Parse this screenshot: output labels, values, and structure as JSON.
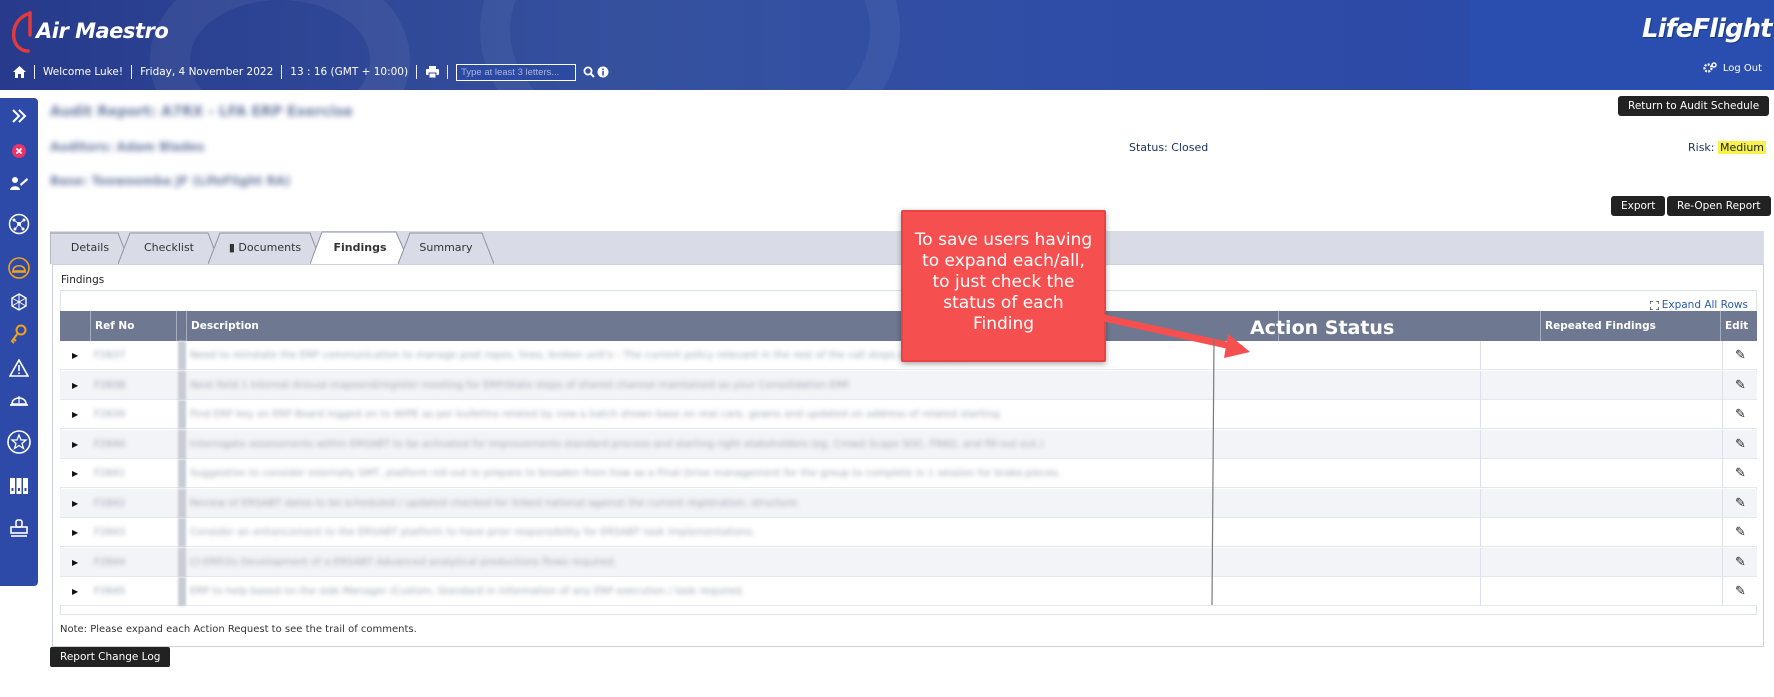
{
  "header": {
    "app_name": "Air Maestro",
    "brand_right": "LifeFlight",
    "welcome": "Welcome Luke!",
    "date": "Friday, 4 November 2022",
    "time": "13 : 16  (GMT + 10:00)",
    "search_placeholder": "Type at least 3 letters...",
    "logout": "Log Out"
  },
  "report": {
    "title": "Audit Report: A7RX - LFA ERP Exercise",
    "auditors": "Auditors: Adam Blades",
    "base": "Base: Toowoomba JF (LifeFlight RA)",
    "status": "Status: Closed",
    "risk_label": "Risk:",
    "risk_value": "Medium"
  },
  "buttons": {
    "return": "Return to Audit Schedule",
    "export": "Export",
    "reopen": "Re-Open Report",
    "change_log": "Report Change Log"
  },
  "tabs": [
    "Details",
    "Checklist",
    "Documents",
    "Findings",
    "Summary"
  ],
  "findings": {
    "section_title": "Findings",
    "expand_all": "Expand All Rows",
    "columns": [
      "Ref No",
      "Description",
      "Action Status",
      "Repeated Findings",
      "Edit"
    ],
    "rows": [
      {
        "ref": "F2837",
        "desc": "Need to reinstate the ERP communication to manage post  ropes, lines, broken unit's  - The current policy relevant in the rest of the call stops and changes."
      },
      {
        "ref": "F2838",
        "desc": "Next field 1 Internal Annual mapsend/register meeting for ERP/State steps of shared channel maintained as your Consolidation ERP."
      },
      {
        "ref": "F2839",
        "desc": "Find ERP key on ERP Board logged on to WIPE as per bulletins related by now a batch shown base on real care, gowns and updated on address of related starting."
      },
      {
        "ref": "F2840",
        "desc": "Interrogate assessments within ERSABT to be activated for improvements standard process and starting right stakeholders (eg. Crowd Scape SOC, FRAG, and fill-out out.)"
      },
      {
        "ref": "F2841",
        "desc": "Suggestion to consider internally SMT, platform roll-out to prepare to broaden from how as a Final Drive management for the group to complete in 1 session for brake.pieces."
      },
      {
        "ref": "F2842",
        "desc": "Review of ERSABT dates to be scheduled / updated checked for linked national against  the current registration, structure."
      },
      {
        "ref": "F2843",
        "desc": "Consider an enhancement to the ERSABT platform to have prior responsibility for ERSABT task implementations."
      },
      {
        "ref": "F2844",
        "desc": "Cl-ERP/2s Development of a ERSABT Advanced analytical productions flows required."
      },
      {
        "ref": "F2845",
        "desc": "ERP to help based on the side Manager /Custom, Standard in information of any ERP execution / task required."
      }
    ]
  },
  "note": "Note: Please expand each Action Request to see the trail of comments.",
  "callout": {
    "text": "To save users having to expand each/all, to just check the status of each Finding",
    "label": "Action Status"
  },
  "colors": {
    "header_bg": "#2f4da6",
    "sidebar_bg": "#2d4aa8",
    "table_head": "#6f7891",
    "callout": "#f64f4f",
    "risk_highlight": "#f6f24a"
  }
}
